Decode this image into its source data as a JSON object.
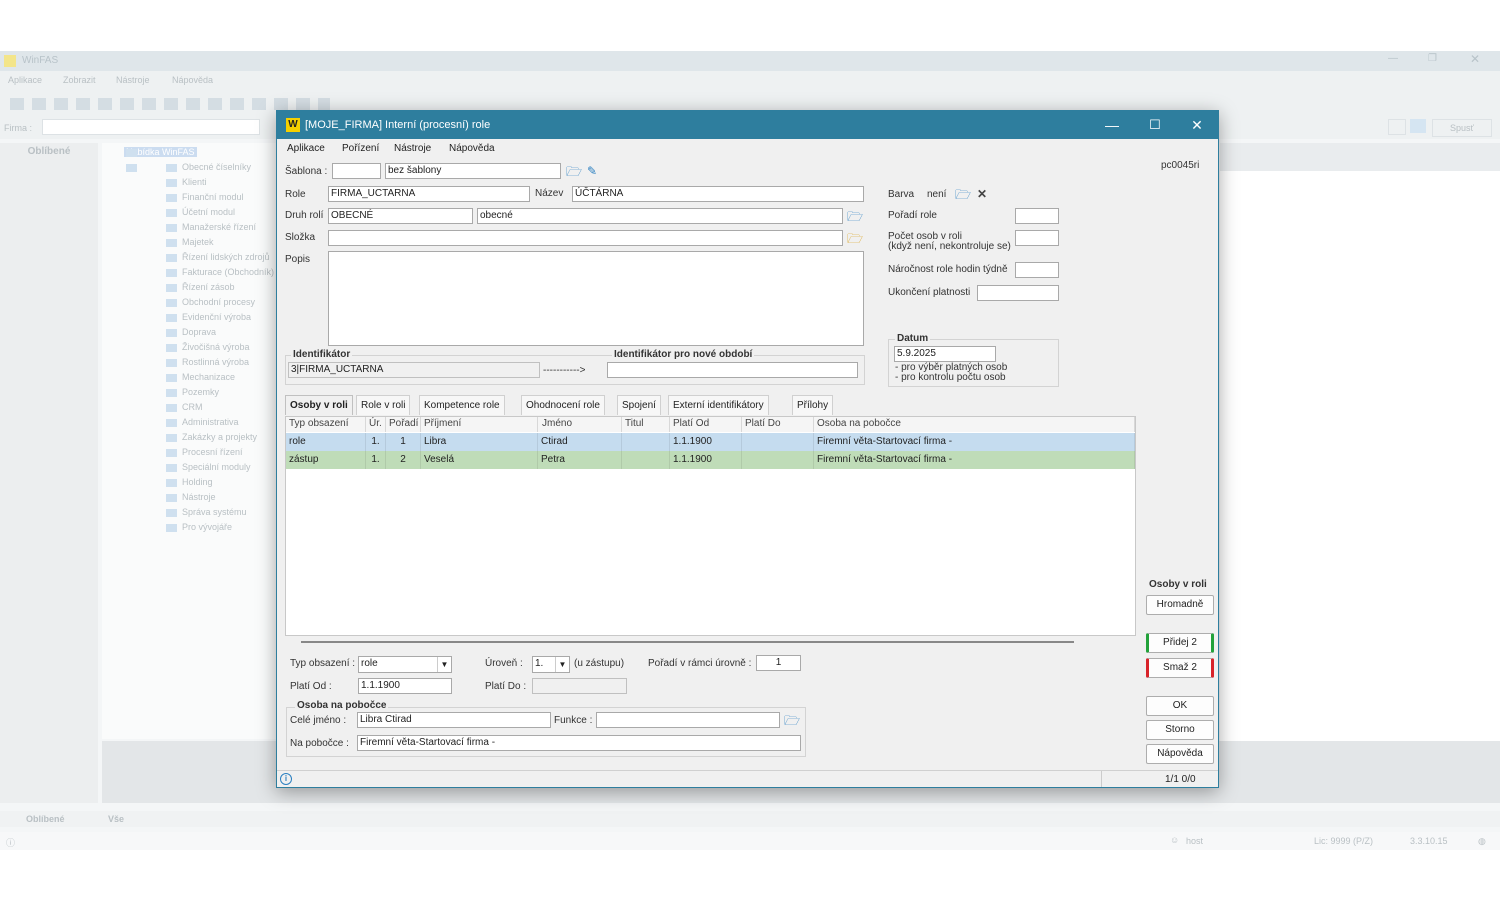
{
  "background": {
    "title": "WinFAS",
    "menu": [
      "Aplikace",
      "Zobrazit",
      "Nástroje",
      "Nápověda"
    ],
    "firm_label": "Firma :",
    "right_button": "Spusť",
    "left_header": "Oblíbené",
    "tree_root": "Nabídka WinFAS",
    "tree_items": [
      "Obecné číselníky",
      "Klienti",
      "Finanční modul",
      "Účetní modul",
      "Manažerské řízení",
      "Majetek",
      "Řízení lidských zdrojů",
      "Fakturace (Obchodník)",
      "Řízení zásob",
      "Obchodní procesy",
      "Evidenční výroba",
      "Doprava",
      "Živočišná výroba",
      "Rostlinná výroba",
      "Mechanizace",
      "Pozemky",
      "CRM",
      "Administrativa",
      "Zakázky a projekty",
      "Procesní řízení",
      "Speciální moduly",
      "Holding",
      "Nástroje",
      "Správa systému",
      "Pro vývojáře"
    ],
    "bottom_tabs": [
      "Oblíbené",
      "Vše"
    ],
    "status": {
      "user": "host",
      "lic": "Lic: 9999 (P/Z)",
      "version": "3.3.10.15"
    }
  },
  "dialog": {
    "title": "[MOJE_FIRMA] Interní (procesní) role",
    "logo": "W",
    "menu": [
      "Aplikace",
      "Pořízení",
      "Nástroje",
      "Nápověda"
    ],
    "code": "pc0045ri",
    "sablona_label": "Šablona :",
    "sablona_code": "",
    "sablona_name": "bez šablony",
    "role_label": "Role",
    "role_value": "FIRMA_UCTARNA",
    "nazev_label": "Název",
    "nazev_value": "ÚČTÁRNA",
    "druh_label": "Druh rolí",
    "druh_code": "OBECNÉ",
    "druh_name": "obecné",
    "slozka_label": "Složka",
    "slozka_value": "",
    "popis_label": "Popis",
    "popis_value": "",
    "barva_label": "Barva",
    "barva_value": "není",
    "poradi_label": "Pořadí role",
    "pocet_label1": "Počet osob v roli",
    "pocet_label2": "(když není, nekontroluje se)",
    "narocnost_label": "Náročnost role hodin týdně",
    "ukonceni_label": "Ukončení platnosti",
    "datum_title": "Datum",
    "datum_value": "5.9.2025",
    "datum_note1": "- pro výběr platných osob",
    "datum_note2": "- pro kontrolu počtu osob",
    "ident_title": "Identifikátor",
    "ident_value": "3|FIRMA_UCTARNA",
    "ident_arrow": "----------->",
    "ident_new_title": "Identifikátor pro nové období",
    "ident_new_value": "",
    "tabs": [
      "Osoby v roli",
      "Role v roli",
      "Kompetence role",
      "Ohodnocení role",
      "Spojení",
      "Externí identifikátory",
      "Přílohy"
    ],
    "grid": {
      "headers": [
        "Typ obsazení",
        "Úr.",
        "Pořadí",
        "Příjmení",
        "Jméno",
        "Titul",
        "Platí Od",
        "Platí Do",
        "Osoba na pobočce"
      ],
      "rows": [
        [
          "role",
          "1.",
          "1",
          "Libra",
          "Ctirad",
          "",
          "1.1.1900",
          "",
          "Firemní věta-Startovací firma  -"
        ],
        [
          "zástup",
          "1.",
          "2",
          "Veselá",
          "Petra",
          "",
          "1.1.1900",
          "",
          "Firemní věta-Startovací firma  -"
        ]
      ],
      "row_colors": [
        "#c5dcef",
        "#bfdcb8"
      ]
    },
    "detail": {
      "typ_label": "Typ obsazení :",
      "typ_value": "role",
      "uroven_label": "Úroveň :",
      "uroven_value": "1.",
      "zastup_note": "(u zástupu)",
      "poradi_label": "Pořadí v rámci úrovně :",
      "poradi_value": "1",
      "od_label": "Platí Od :",
      "od_value": "1.1.1900",
      "do_label": "Platí Do :",
      "do_value": "",
      "osoba_title": "Osoba na pobočce",
      "jmeno_label": "Celé jméno :",
      "jmeno_value": "Libra Ctirad",
      "funkce_label": "Funkce :",
      "funkce_value": "",
      "pobocka_label": "Na pobočce :",
      "pobocka_value": "Firemní věta-Startovací firma  -"
    },
    "side": {
      "section": "Osoby v roli",
      "hromadne": "Hromadně",
      "pridej": "Přidej 2",
      "smaz": "Smaž 2",
      "ok": "OK",
      "storno": "Storno",
      "napoveda": "Nápověda"
    },
    "status": {
      "info": "i",
      "counter": "1/1  0/0"
    }
  }
}
